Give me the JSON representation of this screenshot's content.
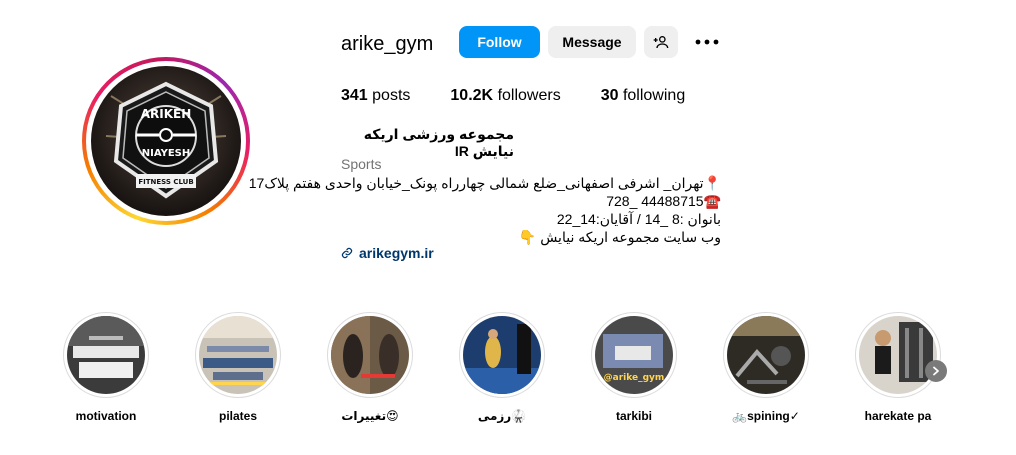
{
  "profile": {
    "username": "arike_gym",
    "follow_label": "Follow",
    "message_label": "Message",
    "avatar_text_top": "ARIKEH",
    "avatar_text_mid": "NIAYESH",
    "avatar_text_bottom": "FITNESS CLUB"
  },
  "stats": [
    {
      "value": "341",
      "label": "posts"
    },
    {
      "value": "10.2K",
      "label": "followers"
    },
    {
      "value": "30",
      "label": "following"
    }
  ],
  "bio": {
    "full_name": "مجموعه ورزشی اریکه نیایش IR",
    "category": "Sports",
    "lines": [
      "📍تهران_ اشرفی اصفهانی_ضلع شمالی چهارراه پونک_خیابان واحدی هفتم پلاک17",
      "☎️44488715 _728",
      "بانوان :8 _14 / آقایان:14_22",
      "وب سایت مجموعه اریکه نیایش 👇"
    ],
    "website": "arikegym.ir"
  },
  "highlights": [
    {
      "label": "motivation"
    },
    {
      "label": "pilates"
    },
    {
      "label": "تغییرات😍"
    },
    {
      "label": "رزمی🥋"
    },
    {
      "label": "tarkibi"
    },
    {
      "label": "🚲spining✓"
    },
    {
      "label": "harekate pa"
    }
  ],
  "highlight_overlay_texts": {
    "tarkibi": "@arike_gym"
  },
  "icons": {
    "add_user": "add-user-icon",
    "more": "more-dots-icon",
    "link": "link-icon",
    "next": "chevron-right-icon"
  },
  "colors": {
    "follow_button": "#0095f6",
    "secondary_button": "#efefef",
    "link_text": "#00376b",
    "muted_text": "#737373"
  }
}
